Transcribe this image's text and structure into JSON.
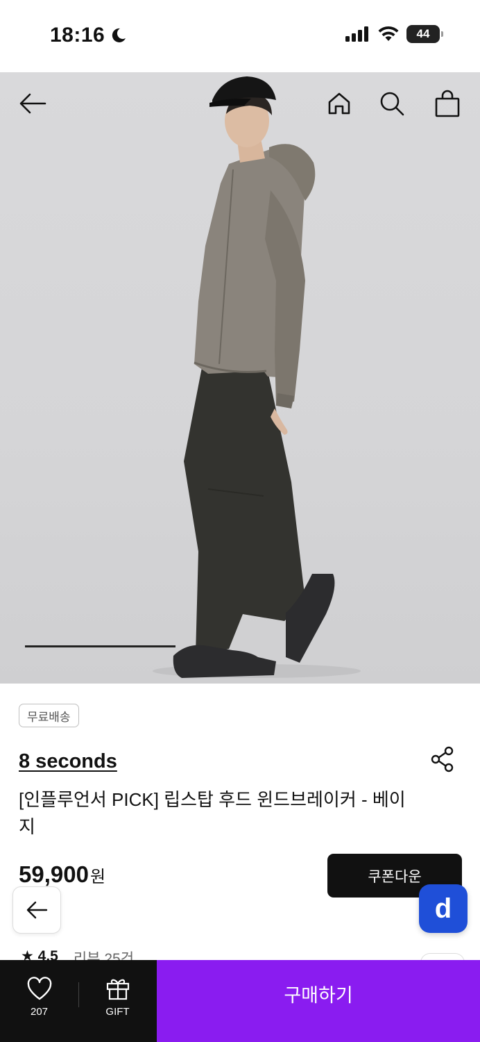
{
  "status_bar": {
    "time": "18:16",
    "battery": "44"
  },
  "hero": {
    "image_progress": 0.35
  },
  "product": {
    "badge": "무료배송",
    "brand": "8 seconds",
    "title": "[인플루언서 PICK] 립스탑 후드 윈드브레이커 - 베이지",
    "price": "59,900",
    "price_unit": "원",
    "coupon_label": "쿠폰다운",
    "rating": "4.5",
    "review_label": "리뷰 25건",
    "floating_logo": "d"
  },
  "bottom_bar": {
    "like_count": "207",
    "gift_label": "GIFT",
    "buy_label": "구매하기"
  },
  "colors": {
    "buy_button": "#8a1cf0",
    "coupon_button": "#111111",
    "floating_d": "#1f4fd8"
  },
  "icons": [
    "back-arrow-icon",
    "home-icon",
    "search-icon",
    "shopping-bag-icon",
    "share-icon",
    "heart-icon",
    "gift-icon",
    "moon-icon",
    "signal-icon",
    "wifi-icon"
  ]
}
